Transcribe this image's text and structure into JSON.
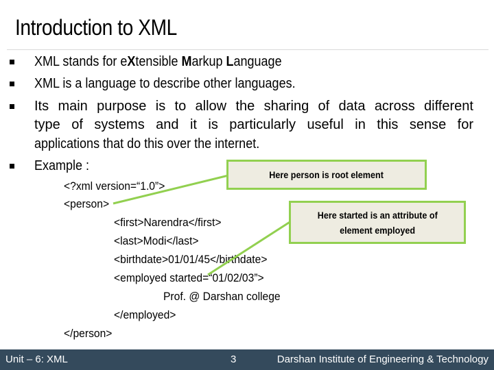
{
  "slide": {
    "title": "Introduction to XML",
    "bullets": [
      {
        "segments": [
          {
            "text": "XML stands for e",
            "bold": false
          },
          {
            "text": "X",
            "bold": true
          },
          {
            "text": "tensible ",
            "bold": false
          },
          {
            "text": "M",
            "bold": true
          },
          {
            "text": "arkup ",
            "bold": false
          },
          {
            "text": "L",
            "bold": true
          },
          {
            "text": "anguage",
            "bold": false
          }
        ]
      },
      {
        "text": "XML is a language to describe other languages."
      },
      {
        "lines": [
          "Its main purpose is to allow the sharing of data across different",
          "type of systems and it is particularly useful in this sense for",
          "applications that do this over the internet."
        ]
      },
      {
        "text": "Example :"
      }
    ],
    "code": [
      "<?xml version=“1.0”>",
      "<person>",
      "<first>Narendra</first>",
      "<last>Modi</last>",
      "<birthdate>01/01/45</birthdate>",
      "<employed started=“01/02/03”>",
      "Prof. @ Darshan college",
      "</employed>",
      "</person>"
    ],
    "callouts": {
      "root": "Here person is root element",
      "attribute_line1": "Here started is an attribute of",
      "attribute_line2": "element employed"
    },
    "colors": {
      "callout_border": "#92d050",
      "callout_fill": "#eeece1",
      "footer_bg": "#344a5c"
    }
  },
  "footer": {
    "unit": "Unit – 6: XML",
    "page": "3",
    "institute": "Darshan Institute of Engineering & Technology"
  }
}
